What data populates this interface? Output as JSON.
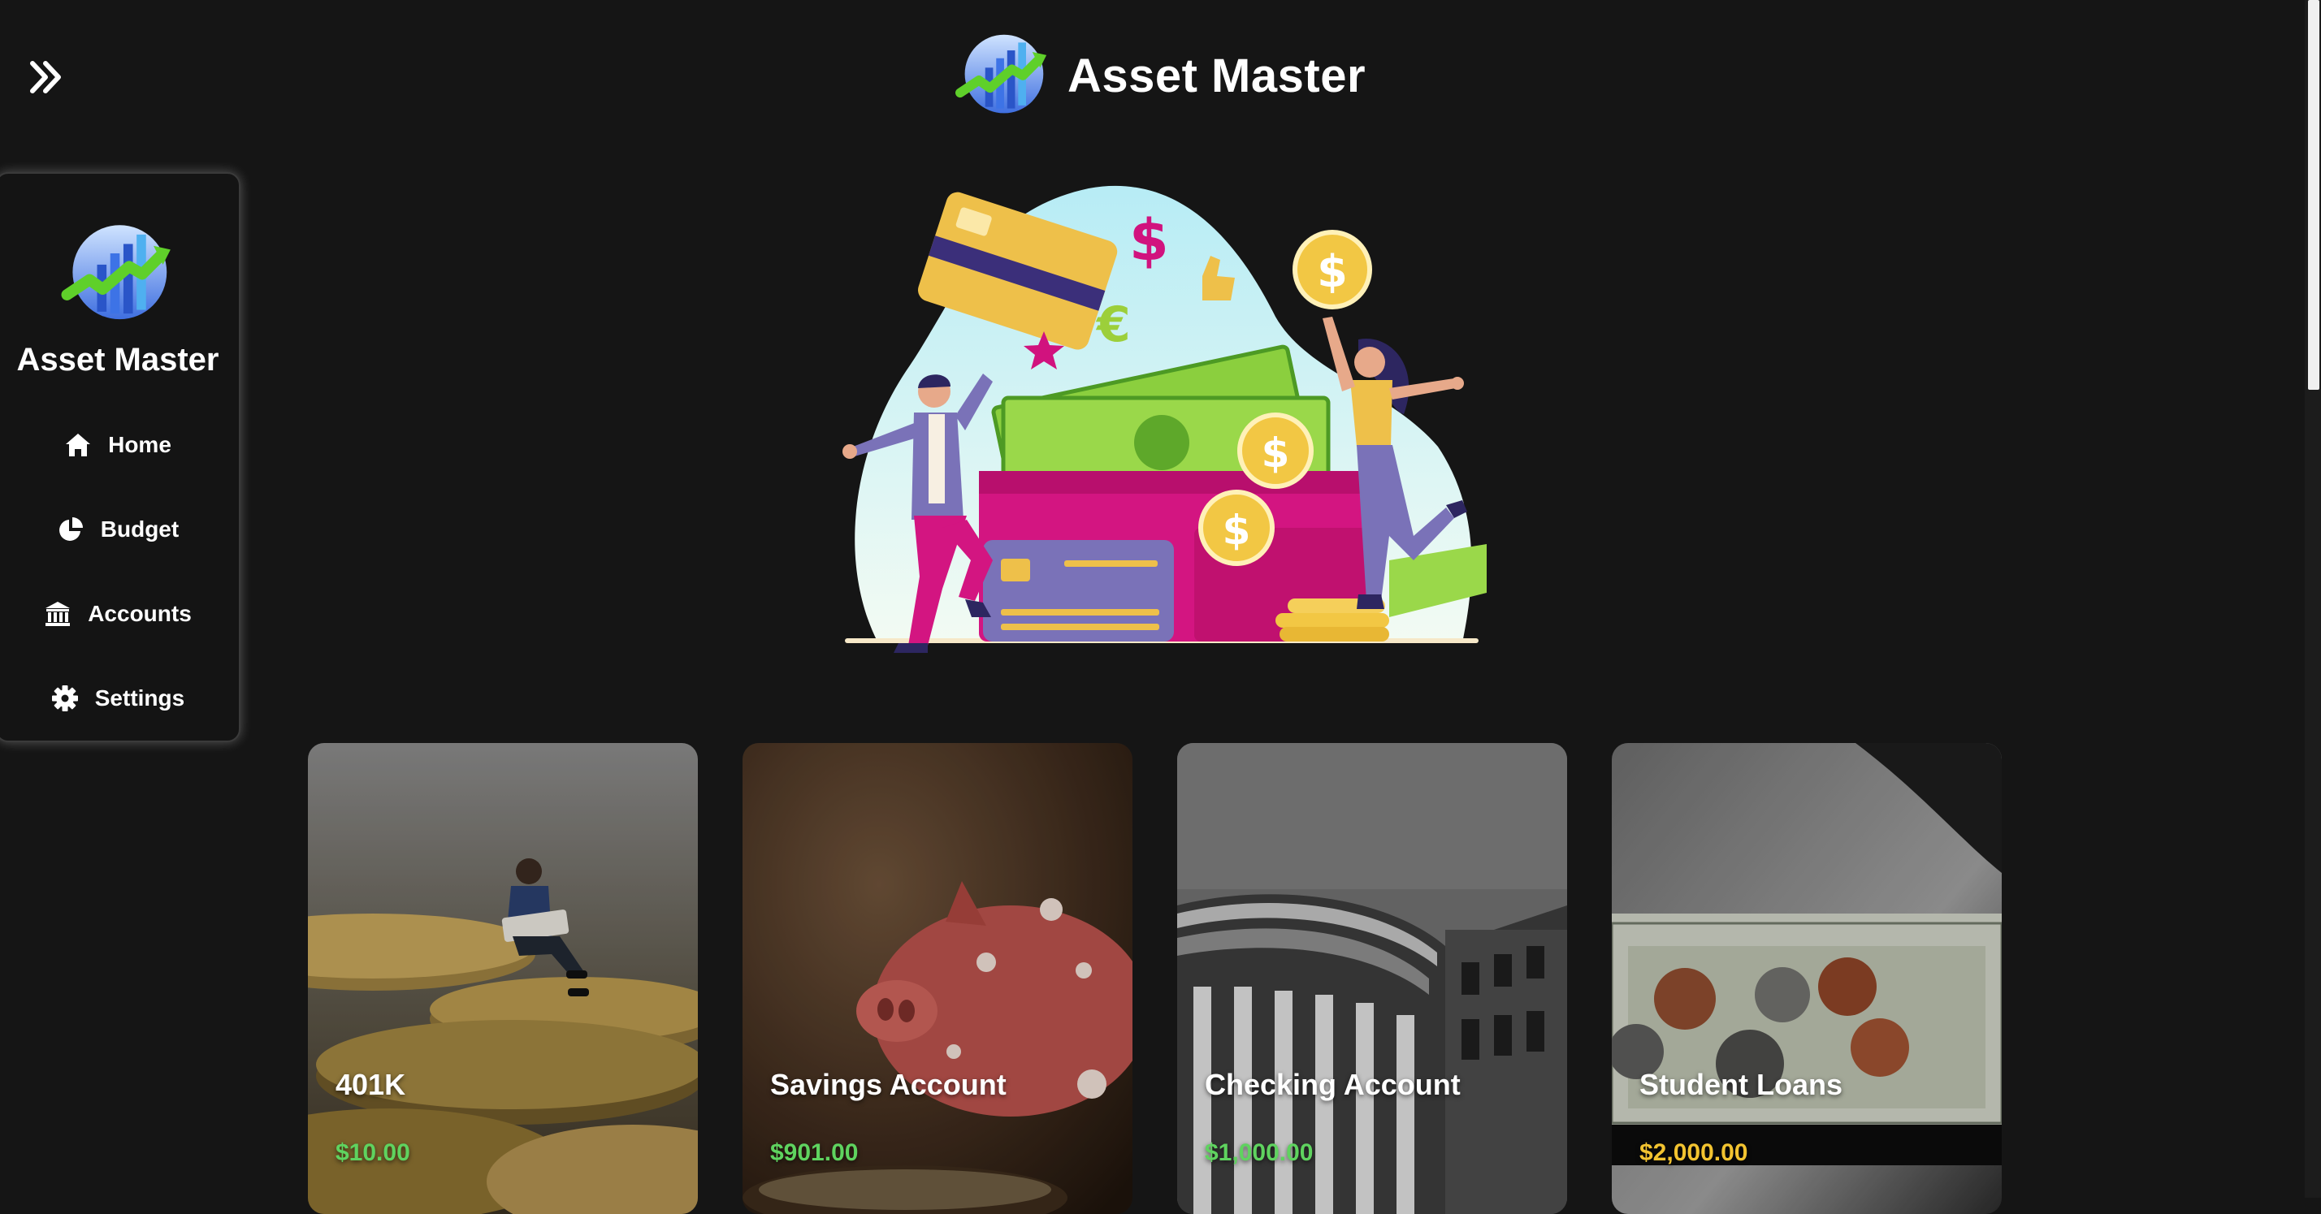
{
  "header": {
    "title": "Asset Master",
    "logo_icon": "growth-chart-globe-icon",
    "toggle_icon": "double-chevron-right-icon"
  },
  "sidebar": {
    "title": "Asset Master",
    "items": [
      {
        "label": "Home",
        "icon": "home-icon"
      },
      {
        "label": "Budget",
        "icon": "pie-chart-icon"
      },
      {
        "label": "Accounts",
        "icon": "bank-icon"
      },
      {
        "label": "Settings",
        "icon": "gear-icon"
      }
    ]
  },
  "cards": [
    {
      "title": "401K",
      "amount": "$10.00",
      "amount_color": "#5fd35f"
    },
    {
      "title": "Savings Account",
      "amount": "$901.00",
      "amount_color": "#5fd35f"
    },
    {
      "title": "Checking Account",
      "amount": "$1,000.00",
      "amount_color": "#5fd35f"
    },
    {
      "title": "Student Loans",
      "amount": "$2,000.00",
      "amount_color": "#f2c330"
    }
  ],
  "colors": {
    "background": "#151515",
    "positive": "#5fd35f",
    "debt": "#f2c330"
  }
}
